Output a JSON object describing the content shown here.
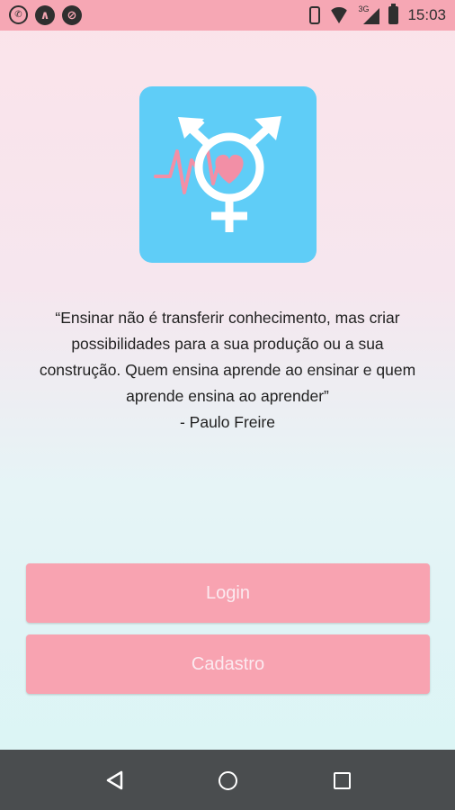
{
  "status_bar": {
    "time": "15:03",
    "network": "3G",
    "icons": [
      "whatsapp-icon",
      "app-a-icon",
      "app-b-icon",
      "vibrate-icon",
      "wifi-icon",
      "signal-icon",
      "battery-icon"
    ]
  },
  "logo": {
    "icon": "transgender-heart-logo",
    "background": "#5fcdf7"
  },
  "quote": {
    "text": "“Ensinar não é transferir conhecimento, mas criar possibilidades para a sua produção ou a sua construção. Quem ensina aprende ao ensinar e quem aprende ensina ao aprender”",
    "author": "- Paulo Freire"
  },
  "buttons": {
    "login": "Login",
    "cadastro": "Cadastro"
  },
  "colors": {
    "accent": "#f8a3b1",
    "status_bar": "#f6a7b4",
    "nav_bar": "#4a4d4f"
  },
  "nav": {
    "icons": [
      "back-icon",
      "home-icon",
      "recents-icon"
    ]
  }
}
